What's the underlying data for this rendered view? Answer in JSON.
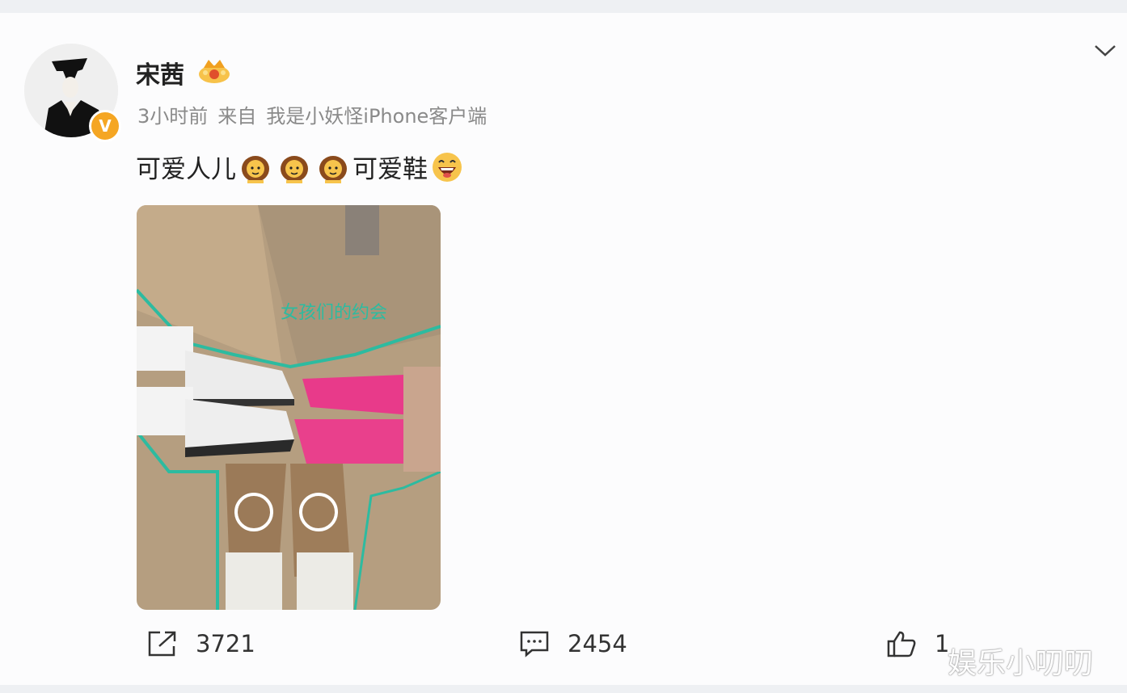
{
  "post": {
    "author": "宋茜",
    "time": "3小时前",
    "from_label": "来自",
    "source": "我是小妖怪iPhone客户端",
    "text_part1": "可爱人儿",
    "text_part2": "可爱鞋",
    "image_caption": "女孩们的约会",
    "verified_badge": "V"
  },
  "actions": {
    "share_count": "3721",
    "comment_count": "2454",
    "like_count": "1"
  },
  "watermark": "娱乐小叨叨",
  "icons": [
    "crown-badge-icon",
    "chevron-down-icon",
    "girl-emoji-icon",
    "laugh-emoji-icon",
    "share-icon",
    "comment-icon",
    "like-icon"
  ],
  "colors": {
    "verified": "#f5a623",
    "text": "#222222",
    "meta": "#8a8a8a"
  }
}
